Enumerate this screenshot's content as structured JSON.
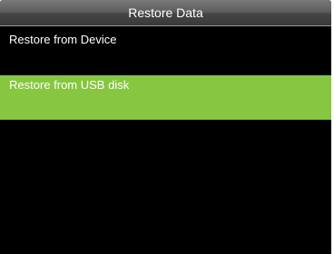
{
  "header": {
    "title": "Restore Data"
  },
  "menu": {
    "items": [
      {
        "label": "Restore from Device",
        "selected": false
      },
      {
        "label": "Restore from USB disk",
        "selected": true
      }
    ]
  },
  "colors": {
    "background": "#000000",
    "header": "#4a4a4a",
    "selected_highlight": "#86c640",
    "text": "#ffffff"
  }
}
